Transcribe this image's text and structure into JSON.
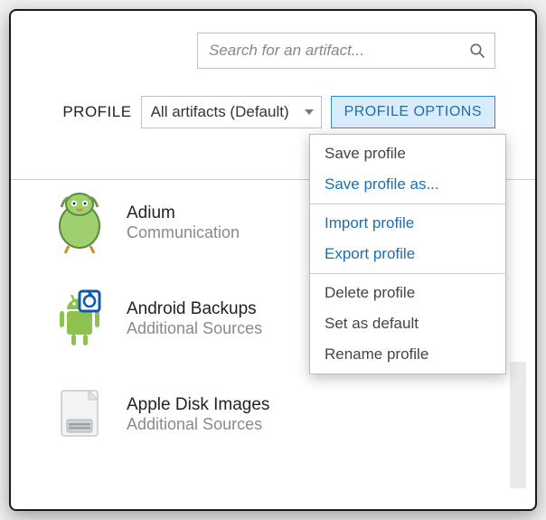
{
  "search": {
    "placeholder": "Search for an artifact..."
  },
  "profile": {
    "label": "PROFILE",
    "selected": "All artifacts (Default)",
    "options_button": "PROFILE OPTIONS"
  },
  "menu": {
    "items": [
      {
        "label": "Save profile",
        "link": false
      },
      {
        "label": "Save profile as...",
        "link": true
      },
      {
        "label": "Import profile",
        "link": true
      },
      {
        "label": "Export profile",
        "link": true
      },
      {
        "label": "Delete profile",
        "link": false
      },
      {
        "label": "Set as default",
        "link": false
      },
      {
        "label": "Rename profile",
        "link": false
      }
    ]
  },
  "artifacts": [
    {
      "name": "Adium",
      "category": "Communication",
      "icon": "adium"
    },
    {
      "name": "Android Backups",
      "category": "Additional Sources",
      "icon": "android"
    },
    {
      "name": "Apple Disk Images",
      "category": "Additional Sources",
      "icon": "disk"
    }
  ]
}
